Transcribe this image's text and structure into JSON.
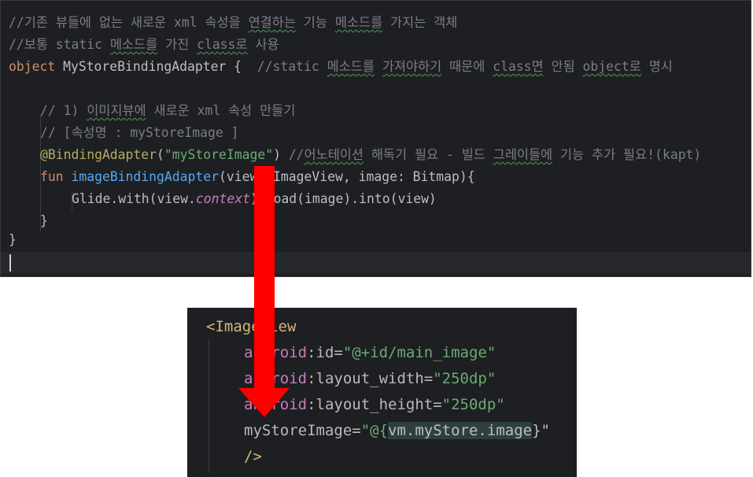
{
  "kotlin": {
    "line1": "//기존 뷰들에 없는 새로운 xml 속성을 연결하는 기능 메소드를 가지는 객체",
    "line2": "//보통 static 메소드를 가진 class로 사용",
    "line3_kw": "object",
    "line3_name": " MyStoreBindingAdapter {  ",
    "line3_comment": "//static 메소드를 가져야하기 때문에 class면 안됨 object로 명시",
    "line5": "// 1) 이미지뷰에 새로운 xml 속성 만들기",
    "line6": "// [속성명 : myStoreImage ]",
    "line7_ann": "@BindingAdapter",
    "line7_open": "(",
    "line7_str": "\"myStoreImage\"",
    "line7_close": ") ",
    "line7_comment": "//어노테이션 해독기 필요 - 빌드 그레이들에 기능 추가 필요!(kapt)",
    "line8_kw": "fun",
    "line8_fn": " imageBindingAdapter",
    "line8_rest": "(view: ImageView, image: Bitmap){",
    "line9_a": "Glide.with(view.",
    "line9_ctx": "context",
    "line9_b": ").load(image).into(view)",
    "line10": "}",
    "line11": "}"
  },
  "xml": {
    "open_tag": "<ImageView",
    "ns": "android",
    "id_attr": ":id=",
    "id_val": "\"@+id/main_image\"",
    "width_attr": ":layout_width=",
    "width_val": "\"250dp\"",
    "height_attr": ":layout_height=",
    "height_val": "\"250dp\"",
    "custom_attr": "myStoreImage=",
    "custom_val_open": "\"@{",
    "custom_val_expr": "vm.myStore.image",
    "custom_val_close": "}\"",
    "close_tag": "/>"
  },
  "colors": {
    "editor_bg": "#1e1f22",
    "arrow": "#ff0000",
    "comment": "#7a7e85",
    "keyword": "#cf8e6d",
    "string": "#6aab73",
    "function": "#56a8f5",
    "annotation": "#b3ae60"
  }
}
